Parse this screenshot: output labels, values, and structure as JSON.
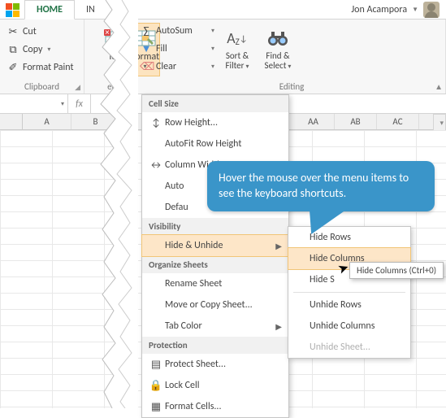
{
  "user": {
    "name": "Jon Acampora"
  },
  "tabs": {
    "home": "HOME",
    "partial": "IN"
  },
  "clipboard": {
    "title": "Clipboard",
    "cut": "Cut",
    "copy": "Copy",
    "format_painter": "Format Paint"
  },
  "cells": {
    "title": "ells",
    "delete_partial": "lete",
    "format": "Format"
  },
  "editing": {
    "title": "Editing",
    "autosum": "AutoSum",
    "fill": "Fill",
    "clear": "Clear",
    "sort": "Sort &",
    "filter": "Filter",
    "find": "Find &",
    "select": "Select"
  },
  "columns": {
    "a": "A",
    "b": "B",
    "aa": "AA",
    "ab": "AB",
    "ac": "AC"
  },
  "menu": {
    "cell_size": "Cell Size",
    "row_height": "Row Height...",
    "autofit_row": "AutoFit Row Height",
    "col_width": "Column Width...",
    "autofit_col_partial": "Auto",
    "default_width_partial": "Defau",
    "visibility": "Visibility",
    "hide_unhide": "Hide & Unhide",
    "organize": "Organize Sheets",
    "rename": "Rename Sheet",
    "move_copy": "Move or Copy Sheet...",
    "tab_color": "Tab Color",
    "protection": "Protection",
    "protect_sheet": "Protect Sheet...",
    "lock_cell": "Lock Cell",
    "format_cells": "Format Cells..."
  },
  "submenu": {
    "hide_rows": "Hide Rows",
    "hide_columns": "Hide Columns",
    "hide_sheet_partial": "Hide S",
    "unhide_rows": "Unhide Rows",
    "unhide_columns": "Unhide Columns",
    "unhide_sheet": "Unhide Sheet..."
  },
  "tooltip": "Hide Columns (Ctrl+0)",
  "callout": "Hover the mouse over the menu items to see the keyboard shortcuts."
}
